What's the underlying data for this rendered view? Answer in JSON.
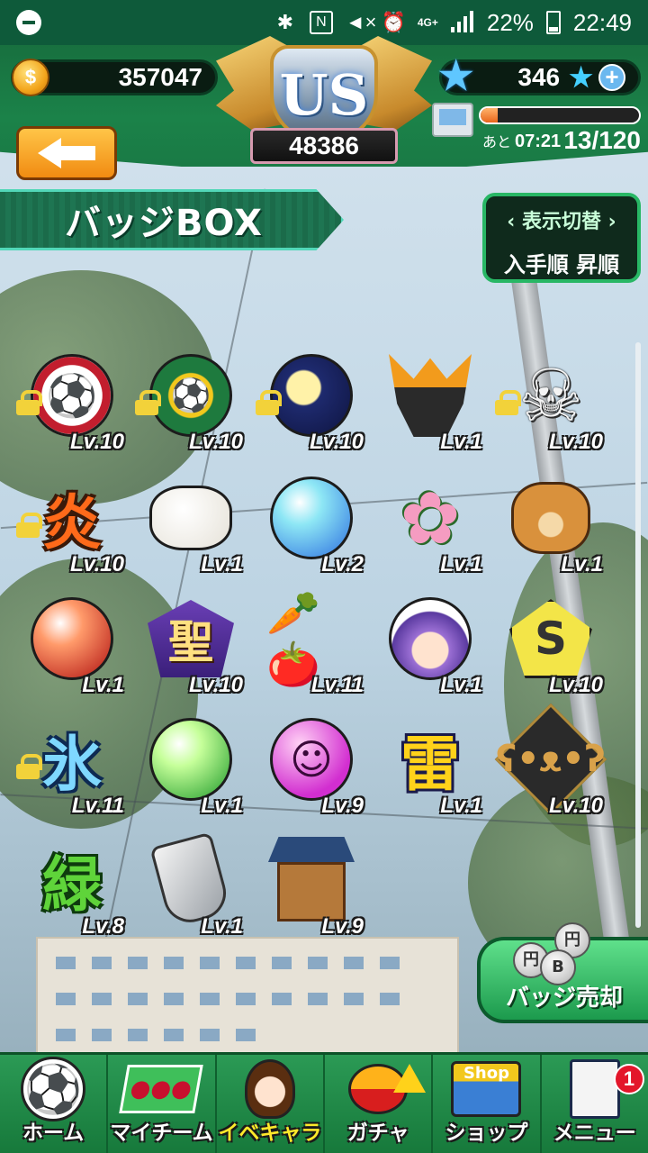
{
  "status_bar": {
    "battery_percent": "22%",
    "time": "22:49",
    "network_label": "4G+"
  },
  "header": {
    "coins": "357047",
    "rank_emblem_text": "US",
    "rank_points": "48386",
    "stars": "346",
    "stamina_timer_prefix": "あと",
    "stamina_timer": "07:21",
    "stamina_count": "13/120",
    "stamina_fill_fraction": 0.11
  },
  "page": {
    "title": "バッジBOX",
    "toggle_label": "表示切替",
    "sort_label": "入手順 昇順"
  },
  "badges": [
    {
      "name": "soccer-ball-badge",
      "level": "10",
      "locked": true
    },
    {
      "name": "international-school-crest-badge",
      "level": "10",
      "locked": true
    },
    {
      "name": "moon-night-badge",
      "level": "10",
      "locked": true
    },
    {
      "name": "samurai-helmet-badge",
      "level": "1",
      "locked": false
    },
    {
      "name": "skull-crossbones-badge",
      "level": "10",
      "locked": true
    },
    {
      "name": "flame-kanji-badge",
      "level": "10",
      "locked": true
    },
    {
      "name": "marshmallow-badge",
      "level": "1",
      "locked": false
    },
    {
      "name": "blue-orb-badge",
      "level": "2",
      "locked": false
    },
    {
      "name": "pink-flower-badge",
      "level": "1",
      "locked": false
    },
    {
      "name": "bear-face-badge",
      "level": "1",
      "locked": false
    },
    {
      "name": "red-orb-badge",
      "level": "1",
      "locked": false
    },
    {
      "name": "holy-kanji-badge",
      "level": "10",
      "locked": false
    },
    {
      "name": "vegetables-badge",
      "level": "11",
      "locked": false
    },
    {
      "name": "girl-portrait-badge",
      "level": "1",
      "locked": false
    },
    {
      "name": "s-chart-pentagon-badge",
      "level": "10",
      "locked": false
    },
    {
      "name": "ice-kanji-badge",
      "level": "11",
      "locked": true
    },
    {
      "name": "green-orb-badge",
      "level": "1",
      "locked": false
    },
    {
      "name": "pink-smile-orb-badge",
      "level": "9",
      "locked": false
    },
    {
      "name": "thunder-kanji-badge",
      "level": "1",
      "locked": false
    },
    {
      "name": "black-bear-badge",
      "level": "10",
      "locked": false
    },
    {
      "name": "green-kanji-badge",
      "level": "8",
      "locked": false
    },
    {
      "name": "gauntlet-badge",
      "level": "1",
      "locked": false
    },
    {
      "name": "gate-badge",
      "level": "9",
      "locked": false
    }
  ],
  "badge_glyphs": {
    "flame": "炎",
    "holy": "聖",
    "ice": "氷",
    "thunder": "雷",
    "green": "緑"
  },
  "level_prefix": "Lv.",
  "sell_button": {
    "label": "バッジ売却"
  },
  "bottom_nav": [
    {
      "label": "ホーム",
      "icon": "soccer-ball-icon"
    },
    {
      "label": "マイチーム",
      "icon": "team-icon"
    },
    {
      "label": "イベキャラ",
      "icon": "character-icon",
      "active": true
    },
    {
      "label": "ガチャ",
      "icon": "gacha-icon",
      "warning": true
    },
    {
      "label": "ショップ",
      "icon": "shop-icon"
    },
    {
      "label": "メニュー",
      "icon": "menu-icon",
      "badge_count": "1"
    }
  ],
  "colors": {
    "header_green": "#1b8249",
    "accent_orange": "#f18b12",
    "lock_yellow": "#f2d23a",
    "active_nav_label": "#ffe92b"
  }
}
